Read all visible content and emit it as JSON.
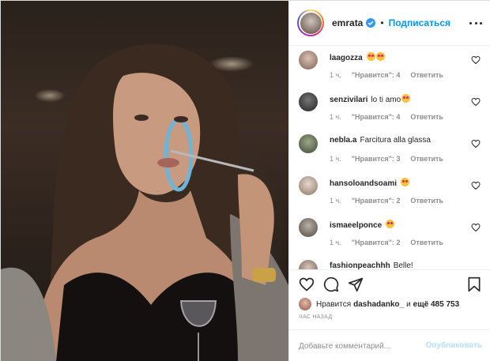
{
  "header": {
    "username": "emrata",
    "dot": "•",
    "follow_label": "Подписаться"
  },
  "comments": [
    {
      "user": "laagozza",
      "text": "",
      "emojis": 2,
      "time": "1 ч.",
      "likes": "\"Нравится\": 4",
      "reply": "Ответить"
    },
    {
      "user": "senzivilari",
      "text": "lo ti amo",
      "emojis": 1,
      "time": "1 ч.",
      "likes": "\"Нравится\": 4",
      "reply": "Ответить"
    },
    {
      "user": "nebla.a",
      "text": "Farcitura alla glassa",
      "emojis": 0,
      "time": "1 ч.",
      "likes": "\"Нравится\": 3",
      "reply": "Ответить"
    },
    {
      "user": "hansoloandsoami",
      "text": "",
      "emojis": 1,
      "time": "1 ч.",
      "likes": "\"Нравится\": 2",
      "reply": "Ответить"
    },
    {
      "user": "ismaeelponce",
      "text": "",
      "emojis": 1,
      "time": "1 ч.",
      "likes": "\"Нравится\": 2",
      "reply": "Ответить"
    },
    {
      "user": "fashionpeachhh",
      "text": "Belle!",
      "emojis": 0,
      "time": "",
      "likes": "",
      "reply": ""
    }
  ],
  "likes": {
    "prefix": "Нравится",
    "user": "dashadanko_",
    "and": "и",
    "count": "ещё 485 753"
  },
  "time_ago": "ЧАС НАЗАД",
  "comment_box": {
    "placeholder": "Добавьте комментарий...",
    "publish_label": "Опубликовать"
  },
  "colors": {
    "link_blue": "#0095f6",
    "publish_disabled": "#b2dffc",
    "meta_gray": "#8e8e8e"
  },
  "icons": [
    "verified-icon",
    "more-options-icon",
    "heart-icon",
    "comment-icon",
    "share-icon",
    "bookmark-icon"
  ]
}
